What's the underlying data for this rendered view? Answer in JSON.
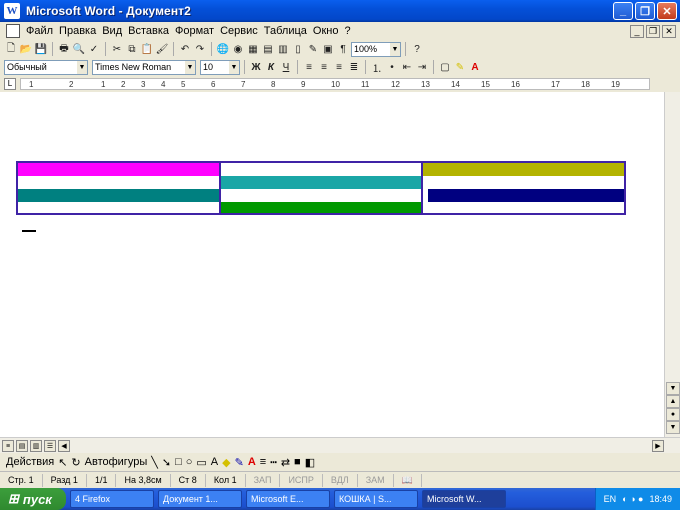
{
  "window": {
    "title": "Microsoft Word - Документ2",
    "icon": "word-icon"
  },
  "menu": [
    "Файл",
    "Правка",
    "Вид",
    "Вставка",
    "Формат",
    "Сервис",
    "Таблица",
    "Окно",
    "?"
  ],
  "toolbar": {
    "zoom": "100%"
  },
  "format": {
    "style": "Обычный",
    "font": "Times New Roman",
    "size": "10",
    "bold": "Ж",
    "italic": "К",
    "underline": "Ч"
  },
  "ruler": {
    "numbers": [
      "1",
      "2",
      "1",
      "2",
      "3",
      "4",
      "5",
      "6",
      "7",
      "8",
      "9",
      "10",
      "11",
      "12",
      "13",
      "14",
      "15",
      "16",
      "17",
      "18",
      "19"
    ]
  },
  "table": {
    "cells": [
      {
        "name": "cell-r1c1",
        "color": "#FF00FF"
      },
      {
        "name": "cell-r2c1",
        "color": "#008080"
      },
      {
        "name": "cell-r1c2",
        "color": "#1AA6A6"
      },
      {
        "name": "cell-r2c2",
        "color": "#009900"
      },
      {
        "name": "cell-r1c3",
        "color": "#B3B300"
      },
      {
        "name": "cell-r2c3",
        "color": "#000080"
      }
    ]
  },
  "drawbar": {
    "actions": "Действия",
    "autoshapes": "Автофигуры"
  },
  "status": {
    "page": "Стр. 1",
    "section": "Разд 1",
    "pages": "1/1",
    "at": "На 3,8см",
    "line": "Ст 8",
    "col": "Кол 1",
    "rec": "ЗАП",
    "trk": "ИСПР",
    "ext": "ВДЛ",
    "ovr": "ЗАМ"
  },
  "taskbar": {
    "start": "пуск",
    "tasks": [
      "4 Firefox",
      "Документ 1...",
      "Microsoft E...",
      "КОШКА | S...",
      "Microsoft W..."
    ],
    "lang": "EN",
    "time": "18:49"
  }
}
